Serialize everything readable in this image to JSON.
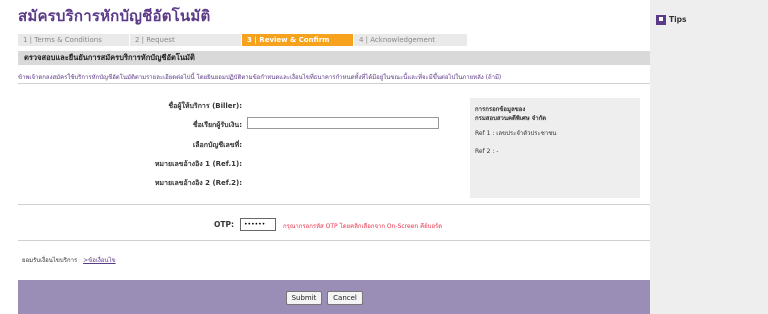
{
  "page": {
    "title": "สมัครบริการหักบัญชีอัตโนมัติ"
  },
  "steps": [
    {
      "label": "1 | Terms & Conditions",
      "active": false
    },
    {
      "label": "2 | Request",
      "active": false
    },
    {
      "label": "3 | Review & Confirm",
      "active": true
    },
    {
      "label": "4 | Acknowledgement",
      "active": false
    }
  ],
  "section": {
    "title": "ตรวจสอบและยืนยันการสมัครบริการหักบัญชีอัตโนมัติ",
    "description": "ข้าพเจ้าตกลงสมัครใช้บริการหักบัญชีอัตโนมัติตามรายละเอียดต่อไปนี้ โดยยินยอมปฏิบัติตามข้อกำหนดและเงื่อนไขที่ธนาคารกำหนดทั้งที่ได้มีอยู่ในขณะนี้และที่จะมีขึ้นต่อไปในภายหลัง (ถ้ามี)"
  },
  "form": {
    "biller_label": "ชื่อผู้ให้บริการ (Biller):",
    "payer_label": "ชื่อเรียกผู้รับเงิน:",
    "payer_value": "",
    "account_label": "เลือกบัญชีเลขที่:",
    "ref1_label": "หมายเลขอ้างอิง 1 (Ref.1):",
    "ref2_label": "หมายเลขอ้างอิง 2 (Ref.2):"
  },
  "info": {
    "line1": "การกรอกข้อมูลของ",
    "line2": "กรมสอบสวนคดีพิเศษ จำกัด",
    "ref1": "Ref 1 : เลขประจำตัวประชาชน",
    "ref2": "Ref 2 : -"
  },
  "otp": {
    "label": "OTP:",
    "value": "••••••",
    "note": "กรุณากรอกรหัส OTP โดยคลิกเลือกจาก On-Screen คีย์บอร์ด"
  },
  "terms": {
    "text": "ยอมรับเงื่อนไขบริการ",
    "link": ">ข้อเงื่อนไข"
  },
  "actions": {
    "submit": "Submit",
    "cancel": "Cancel"
  },
  "sidebar": {
    "tips_label": "Tips"
  },
  "colors": {
    "brand": "#5b3a87",
    "active_step": "#f7a21c",
    "footer": "#9b8eb6",
    "warning": "#e8334a"
  }
}
